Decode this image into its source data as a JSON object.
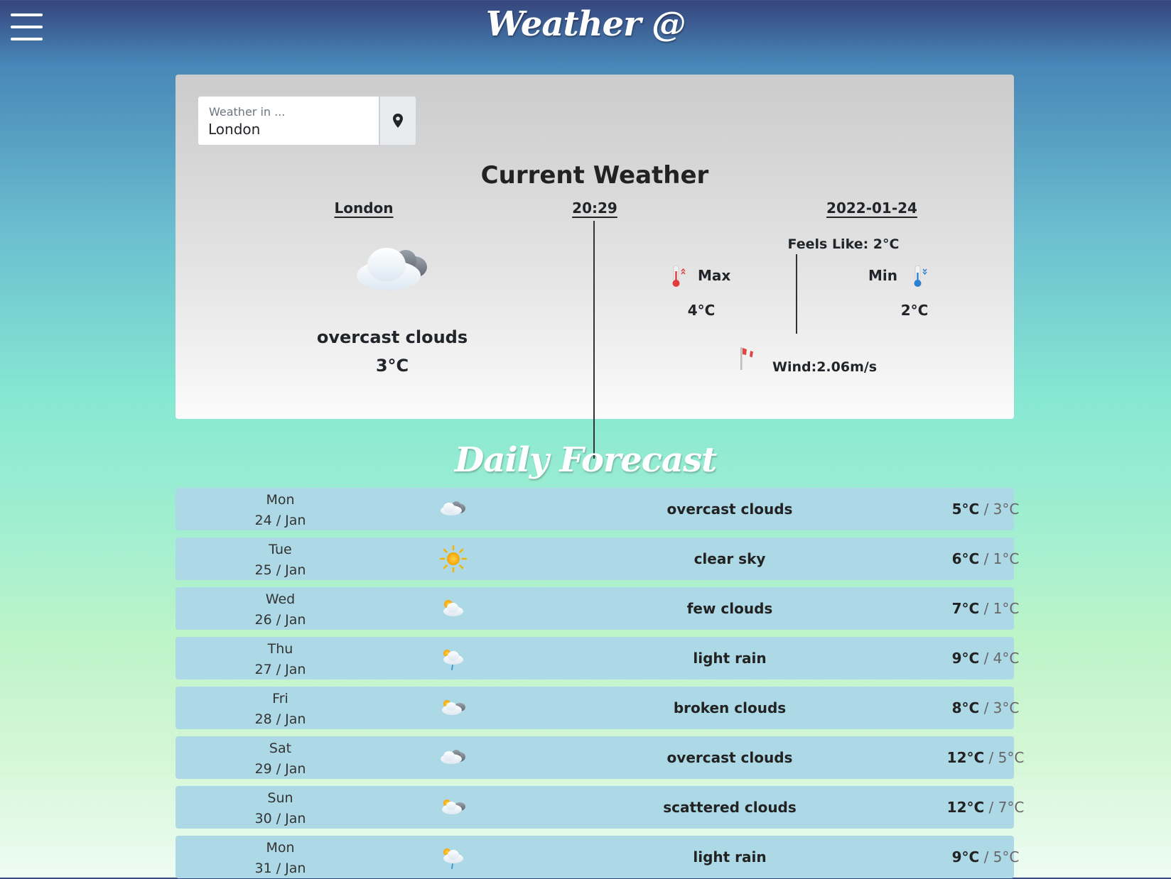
{
  "header": {
    "brand": "Weather @",
    "menu_icon": "hamburger-menu-icon"
  },
  "search": {
    "placeholder": "Weather in ...",
    "value": "London",
    "location_icon": "map-pin-icon"
  },
  "current": {
    "title": "Current Weather",
    "city": "London",
    "time": "20:29",
    "date": "2022-01-24",
    "description": "overcast clouds",
    "temp": "3°C",
    "icon": "overcast-clouds-icon",
    "feels_like": "Feels Like: 2°C",
    "max_label": "Max",
    "max_value": "4°C",
    "min_label": "Min",
    "min_value": "2°C",
    "wind": "Wind:2.06m/s"
  },
  "forecast": {
    "title": "Daily Forecast",
    "days": [
      {
        "day": "Mon",
        "date": "24 / Jan",
        "desc": "overcast clouds",
        "hi": "5°C",
        "lo": " / 3°C",
        "icon": "overcast-clouds-icon"
      },
      {
        "day": "Tue",
        "date": "25 / Jan",
        "desc": "clear sky",
        "hi": "6°C",
        "lo": " / 1°C",
        "icon": "sun-icon"
      },
      {
        "day": "Wed",
        "date": "26 / Jan",
        "desc": "few clouds",
        "hi": "7°C",
        "lo": " / 1°C",
        "icon": "few-clouds-icon"
      },
      {
        "day": "Thu",
        "date": "27 / Jan",
        "desc": "light rain",
        "hi": "9°C",
        "lo": " / 4°C",
        "icon": "light-rain-icon"
      },
      {
        "day": "Fri",
        "date": "28 / Jan",
        "desc": "broken clouds",
        "hi": "8°C",
        "lo": " / 3°C",
        "icon": "broken-clouds-icon"
      },
      {
        "day": "Sat",
        "date": "29 / Jan",
        "desc": "overcast clouds",
        "hi": "12°C",
        "lo": " / 5°C",
        "icon": "overcast-clouds-icon"
      },
      {
        "day": "Sun",
        "date": "30 / Jan",
        "desc": "scattered clouds",
        "hi": "12°C",
        "lo": " / 7°C",
        "icon": "scattered-clouds-icon"
      },
      {
        "day": "Mon",
        "date": "31 / Jan",
        "desc": "light rain",
        "hi": "9°C",
        "lo": " / 5°C",
        "icon": "light-rain-icon"
      }
    ]
  }
}
